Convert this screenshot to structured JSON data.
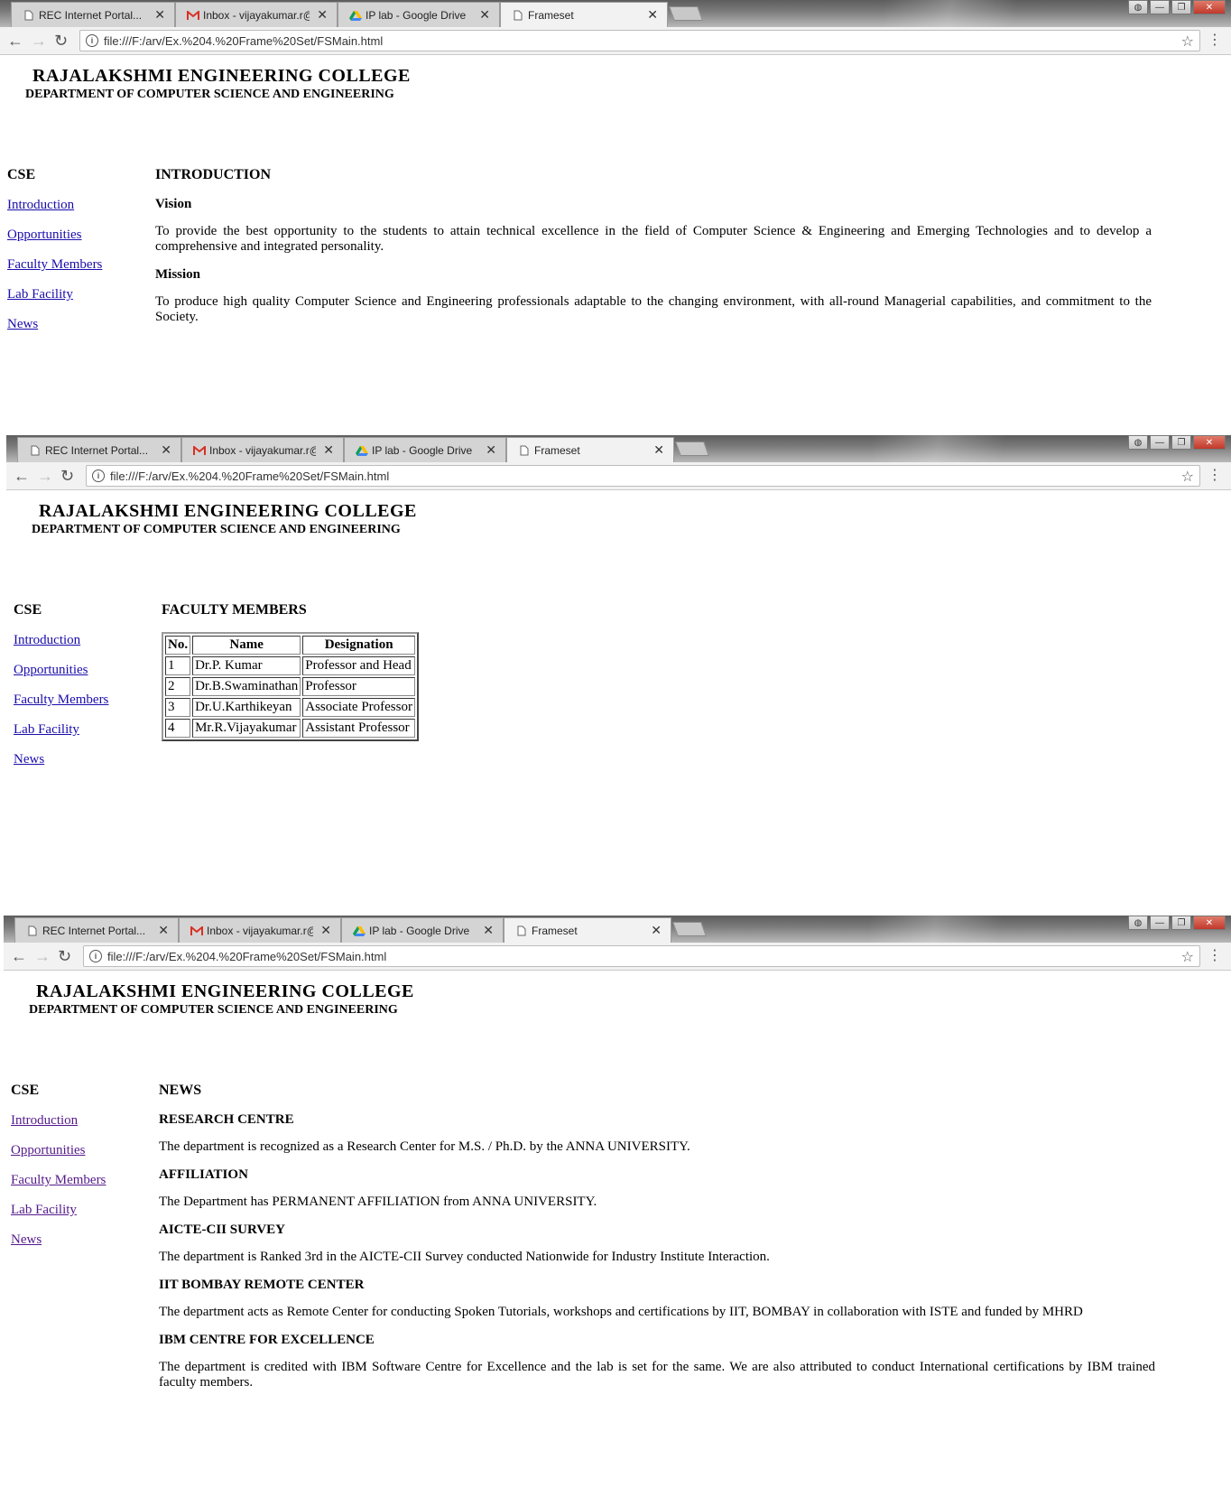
{
  "browser": {
    "tabs": [
      {
        "title": "REC Internet Portal...",
        "icon": "page-icon"
      },
      {
        "title": "Inbox - vijayakumar.r@ra",
        "icon": "gmail-icon"
      },
      {
        "title": "IP lab - Google Drive",
        "icon": "drive-icon"
      },
      {
        "title": "Frameset",
        "icon": "page-icon"
      }
    ],
    "url": "file:///F:/arv/Ex.%204.%20Frame%20Set/FSMain.html",
    "close_glyph": "✕"
  },
  "page": {
    "college": "RAJALAKSHMI ENGINEERING COLLEGE",
    "department": "DEPARTMENT OF COMPUTER SCIENCE AND ENGINEERING",
    "sidebar": {
      "heading": "CSE",
      "links": [
        "Introduction",
        "Opportunities",
        "Faculty Members",
        "Lab Facility",
        "News"
      ]
    }
  },
  "intro": {
    "heading": "INTRODUCTION",
    "vision_heading": "Vision",
    "vision_text": "To provide the best opportunity to the students to attain technical excellence in the field of Computer Science & Engineering and Emerging Technologies and to develop a comprehensive and integrated personality.",
    "mission_heading": "Mission",
    "mission_text": "To produce high quality Computer Science and Engineering professionals adaptable to the changing environment, with all-round Managerial capabilities, and commitment to the Society."
  },
  "faculty": {
    "heading": "FACULTY MEMBERS",
    "columns": [
      "No.",
      "Name",
      "Designation"
    ],
    "rows": [
      [
        "1",
        "Dr.P. Kumar",
        "Professor and Head"
      ],
      [
        "2",
        "Dr.B.Swaminathan",
        "Professor"
      ],
      [
        "3",
        "Dr.U.Karthikeyan",
        "Associate Professor"
      ],
      [
        "4",
        "Mr.R.Vijayakumar",
        "Assistant Professor"
      ]
    ]
  },
  "news": {
    "heading": "NEWS",
    "items": [
      {
        "title": "RESEARCH CENTRE",
        "text": "The department is recognized as a Research Center for M.S. / Ph.D. by the ANNA UNIVERSITY."
      },
      {
        "title": "AFFILIATION",
        "text": "The Department has PERMANENT AFFILIATION from ANNA UNIVERSITY."
      },
      {
        "title": "AICTE-CII SURVEY",
        "text": "The department is Ranked 3rd in the AICTE-CII Survey conducted Nationwide for Industry Institute Interaction."
      },
      {
        "title": "IIT BOMBAY REMOTE CENTER",
        "text": "The department acts as Remote Center for conducting Spoken Tutorials, workshops and certifications by IIT, BOMBAY in collaboration with ISTE and funded by MHRD"
      },
      {
        "title": "IBM CENTRE FOR EXCELLENCE",
        "text": "The department is credited with IBM Software Centre for Excellence and the lab is set for the same. We are also attributed to conduct International certifications by IBM trained faculty members."
      }
    ]
  }
}
